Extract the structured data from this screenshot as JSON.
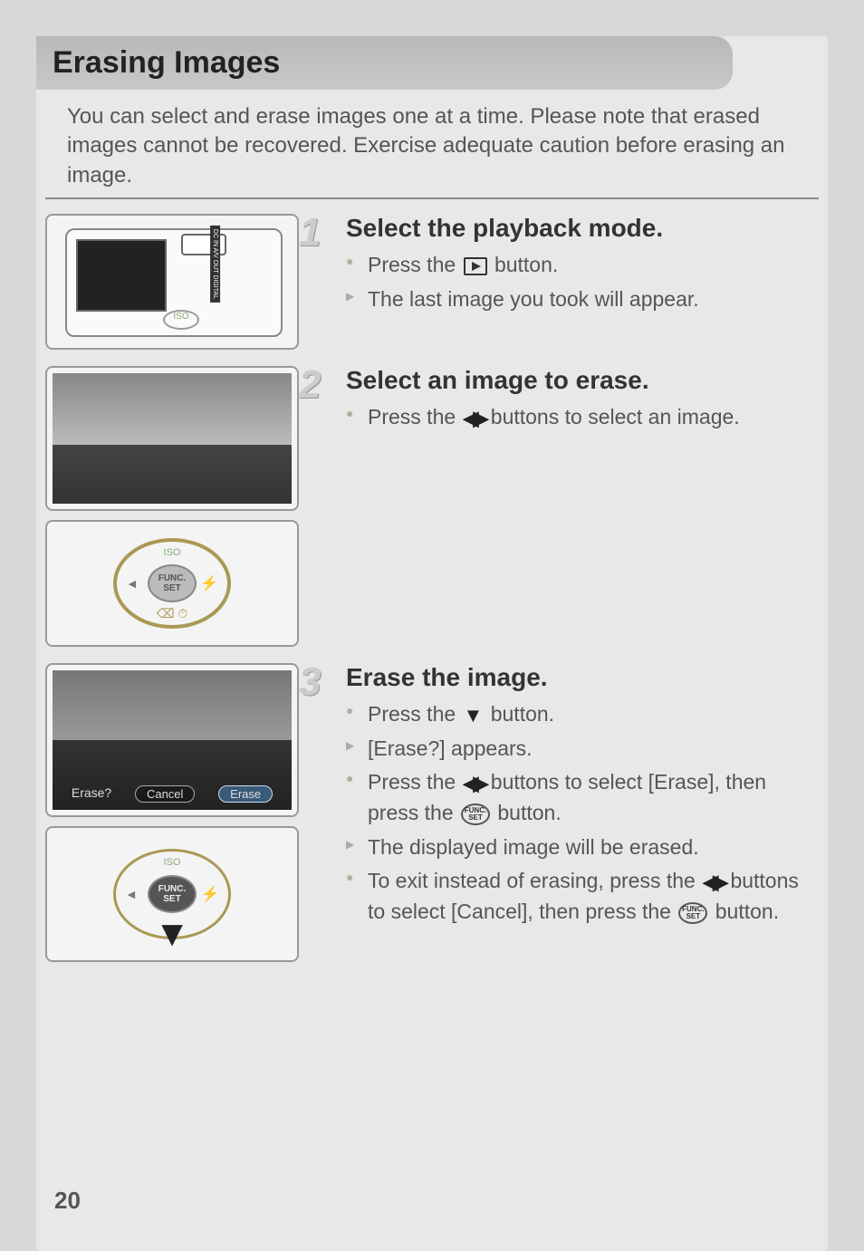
{
  "header": {
    "title": "Erasing Images"
  },
  "intro": "You can select and erase images one at a time. Please note that erased images cannot be recovered. Exercise adequate caution before erasing an image.",
  "steps": [
    {
      "num": "1",
      "title": "Select the playback mode.",
      "bullets": [
        {
          "type": "dot",
          "pre": "Press the ",
          "icon": "play-box",
          "post": " button."
        },
        {
          "type": "arrow",
          "pre": "The last image you took will appear.",
          "icon": null,
          "post": ""
        }
      ]
    },
    {
      "num": "2",
      "title": "Select an image to erase.",
      "bullets": [
        {
          "type": "dot",
          "pre": "Press the ",
          "icon": "lr",
          "post": " buttons to select an image."
        }
      ]
    },
    {
      "num": "3",
      "title": "Erase the image.",
      "bullets": [
        {
          "type": "dot",
          "pre": "Press the ",
          "icon": "down",
          "post": " button."
        },
        {
          "type": "arrow",
          "pre": "[Erase?] appears.",
          "icon": null,
          "post": ""
        },
        {
          "type": "dot",
          "pre": "Press the ",
          "icon": "lr",
          "post": " buttons to select [Erase], then press the ",
          "icon2": "func",
          "post2": " button."
        },
        {
          "type": "arrow",
          "pre": "The displayed image will be erased.",
          "icon": null,
          "post": ""
        },
        {
          "type": "dot",
          "pre": "To exit instead of erasing, press the ",
          "icon": "lr",
          "post": " buttons to select [Cancel], then press the ",
          "icon2": "func",
          "post2": " button."
        }
      ]
    }
  ],
  "illus": {
    "camera_port": "A/V OUT",
    "camera_label": "DC IN A/V OUT DIGITAL",
    "camera_iso": "ISO",
    "dial_iso": "ISO",
    "dial_func": "FUNC.",
    "dial_set": "SET",
    "erase_q": "Erase?",
    "erase_cancel": "Cancel",
    "erase_erase": "Erase"
  },
  "page_number": "20"
}
